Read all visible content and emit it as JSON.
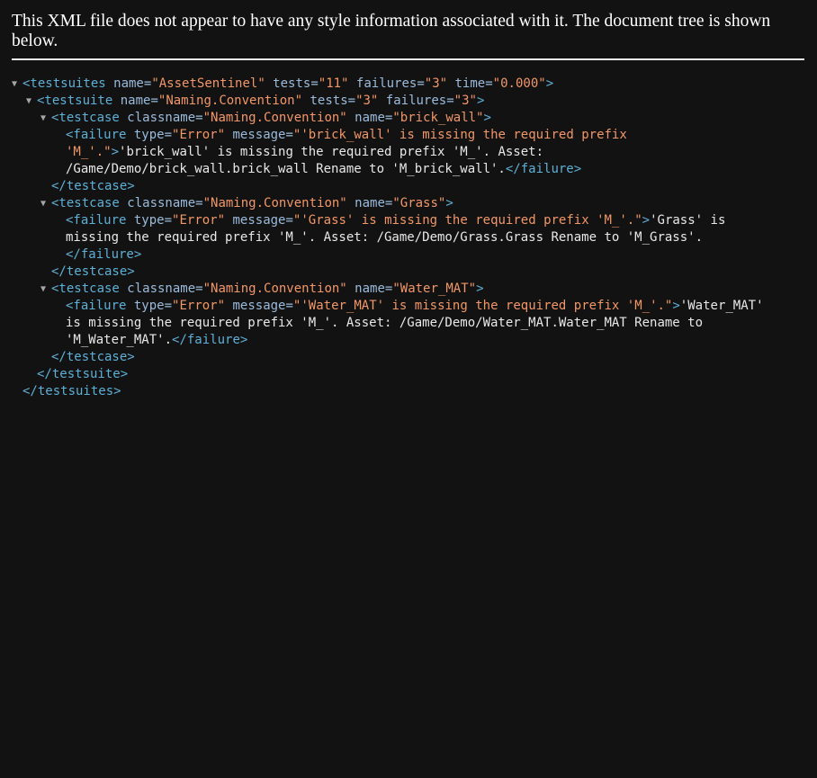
{
  "notice": "This XML file does not appear to have any style information associated with it. The document tree is shown below.",
  "colors": {
    "background": "#121212",
    "tag": "#5db0d7",
    "attr_name": "#9bbbdc",
    "attr_value": "#f29766",
    "text": "#e8e8e8"
  },
  "lines": [
    {
      "parts": [
        [
          "tag",
          "<testsuites"
        ],
        [
          "attr-name",
          " name"
        ],
        [
          "eq",
          "="
        ],
        [
          "attr-val",
          "\"AssetSentinel\""
        ],
        [
          "attr-name",
          " tests"
        ],
        [
          "eq",
          "="
        ],
        [
          "attr-val",
          "\"11\""
        ],
        [
          "attr-name",
          " failures"
        ],
        [
          "eq",
          "="
        ],
        [
          "attr-val",
          "\"3\""
        ],
        [
          "attr-name",
          " time"
        ],
        [
          "eq",
          "="
        ],
        [
          "attr-val",
          "\"0.000\""
        ],
        [
          "tag",
          ">"
        ]
      ]
    },
    {
      "parts": [
        [
          "tag",
          "<testsuite"
        ],
        [
          "attr-name",
          " name"
        ],
        [
          "eq",
          "="
        ],
        [
          "attr-val",
          "\"Naming.Convention\""
        ],
        [
          "attr-name",
          " tests"
        ],
        [
          "eq",
          "="
        ],
        [
          "attr-val",
          "\"3\""
        ],
        [
          "attr-name",
          " failures"
        ],
        [
          "eq",
          "="
        ],
        [
          "attr-val",
          "\"3\""
        ],
        [
          "tag",
          ">"
        ]
      ]
    },
    {
      "parts": [
        [
          "tag",
          "<testcase"
        ],
        [
          "attr-name",
          " classname"
        ],
        [
          "eq",
          "="
        ],
        [
          "attr-val",
          "\"Naming.Convention\""
        ],
        [
          "attr-name",
          " name"
        ],
        [
          "eq",
          "="
        ],
        [
          "attr-val",
          "\"brick_wall\""
        ],
        [
          "tag",
          ">"
        ]
      ]
    },
    {
      "parts": [
        [
          "tag",
          "<failure"
        ],
        [
          "attr-name",
          " type"
        ],
        [
          "eq",
          "="
        ],
        [
          "attr-val",
          "\"Error\""
        ],
        [
          "attr-name",
          " message"
        ],
        [
          "eq",
          "="
        ],
        [
          "attr-val",
          "\"'brick_wall' is missing the required prefix"
        ]
      ]
    },
    {
      "parts": [
        [
          "attr-val",
          "'M_'.\""
        ],
        [
          "tag",
          ">"
        ],
        [
          "txt",
          "'brick_wall' is missing the required prefix 'M_'. Asset:"
        ]
      ]
    },
    {
      "parts": [
        [
          "txt",
          "/Game/Demo/brick_wall.brick_wall Rename to 'M_brick_wall'."
        ],
        [
          "tag",
          "</failure>"
        ]
      ]
    },
    {
      "parts": [
        [
          "tag",
          "</testcase>"
        ]
      ]
    },
    {
      "parts": [
        [
          "tag",
          "<testcase"
        ],
        [
          "attr-name",
          " classname"
        ],
        [
          "eq",
          "="
        ],
        [
          "attr-val",
          "\"Naming.Convention\""
        ],
        [
          "attr-name",
          " name"
        ],
        [
          "eq",
          "="
        ],
        [
          "attr-val",
          "\"Grass\""
        ],
        [
          "tag",
          ">"
        ]
      ]
    },
    {
      "parts": [
        [
          "tag",
          "<failure"
        ],
        [
          "attr-name",
          " type"
        ],
        [
          "eq",
          "="
        ],
        [
          "attr-val",
          "\"Error\""
        ],
        [
          "attr-name",
          " message"
        ],
        [
          "eq",
          "="
        ],
        [
          "attr-val",
          "\"'Grass' is missing the required prefix 'M_'.\""
        ],
        [
          "tag",
          ">"
        ],
        [
          "txt",
          "'Grass' is"
        ]
      ]
    },
    {
      "parts": [
        [
          "txt",
          "missing the required prefix 'M_'. Asset: /Game/Demo/Grass.Grass Rename to 'M_Grass'."
        ]
      ]
    },
    {
      "parts": [
        [
          "tag",
          "</failure>"
        ]
      ]
    },
    {
      "parts": [
        [
          "tag",
          "</testcase>"
        ]
      ]
    },
    {
      "parts": [
        [
          "tag",
          "<testcase"
        ],
        [
          "attr-name",
          " classname"
        ],
        [
          "eq",
          "="
        ],
        [
          "attr-val",
          "\"Naming.Convention\""
        ],
        [
          "attr-name",
          " name"
        ],
        [
          "eq",
          "="
        ],
        [
          "attr-val",
          "\"Water_MAT\""
        ],
        [
          "tag",
          ">"
        ]
      ]
    },
    {
      "parts": [
        [
          "tag",
          "<failure"
        ],
        [
          "attr-name",
          " type"
        ],
        [
          "eq",
          "="
        ],
        [
          "attr-val",
          "\"Error\""
        ],
        [
          "attr-name",
          " message"
        ],
        [
          "eq",
          "="
        ],
        [
          "attr-val",
          "\"'Water_MAT' is missing the required prefix 'M_'.\""
        ],
        [
          "tag",
          ">"
        ],
        [
          "txt",
          "'Water_MAT'"
        ]
      ]
    },
    {
      "parts": [
        [
          "txt",
          "is missing the required prefix 'M_'. Asset: /Game/Demo/Water_MAT.Water_MAT Rename to"
        ]
      ]
    },
    {
      "parts": [
        [
          "txt",
          "'M_Water_MAT'."
        ],
        [
          "tag",
          "</failure>"
        ]
      ]
    },
    {
      "parts": [
        [
          "tag",
          "</testcase>"
        ]
      ]
    },
    {
      "parts": [
        [
          "tag",
          "</testsuite>"
        ]
      ]
    },
    {
      "parts": [
        [
          "tag",
          "</testsuites>"
        ]
      ]
    }
  ],
  "arrow_glyph": "▼"
}
